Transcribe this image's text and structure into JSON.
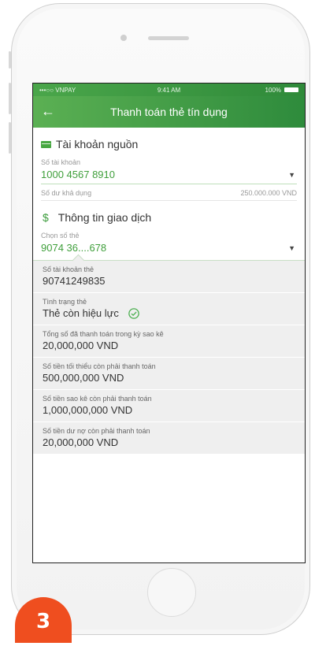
{
  "status_bar": {
    "carrier": "•••○○ VNPAY",
    "time": "9:41 AM",
    "battery": "100%"
  },
  "nav": {
    "title": "Thanh toán thẻ tín dụng",
    "back_icon": "arrow-left-icon"
  },
  "source_account": {
    "heading": "Tài khoản nguồn",
    "account_label": "Số tài khoản",
    "account_value": "1000 4567 8910",
    "balance_label": "Số dư khả dụng",
    "balance_value": "250.000.000 VND"
  },
  "transaction_info": {
    "heading": "Thông tin giao dịch",
    "card_select_label": "Chọn số thẻ",
    "card_select_value": "9074 36....678"
  },
  "details": [
    {
      "label": "Số tài khoản thẻ",
      "value": "90741249835"
    },
    {
      "label": "Tình trạng thẻ",
      "value": "Thẻ còn hiệu lực"
    },
    {
      "label": "Tổng số đã thanh toán trong kỳ sao kê",
      "value": "20,000,000 VND"
    },
    {
      "label": "Số tiền tối thiểu còn phải thanh toán",
      "value": "500,000,000 VND"
    },
    {
      "label": "Số tiền sao kê còn phải thanh toán",
      "value": "1,000,000,000 VND"
    },
    {
      "label": "Số tiền dư nợ còn phải thanh toán",
      "value": "20,000,000 VND"
    }
  ],
  "step_badge": "3",
  "colors": {
    "accent_green": "#3f9f3b",
    "header_green": "#2e8b3c",
    "badge_orange": "#ef4e1f"
  }
}
